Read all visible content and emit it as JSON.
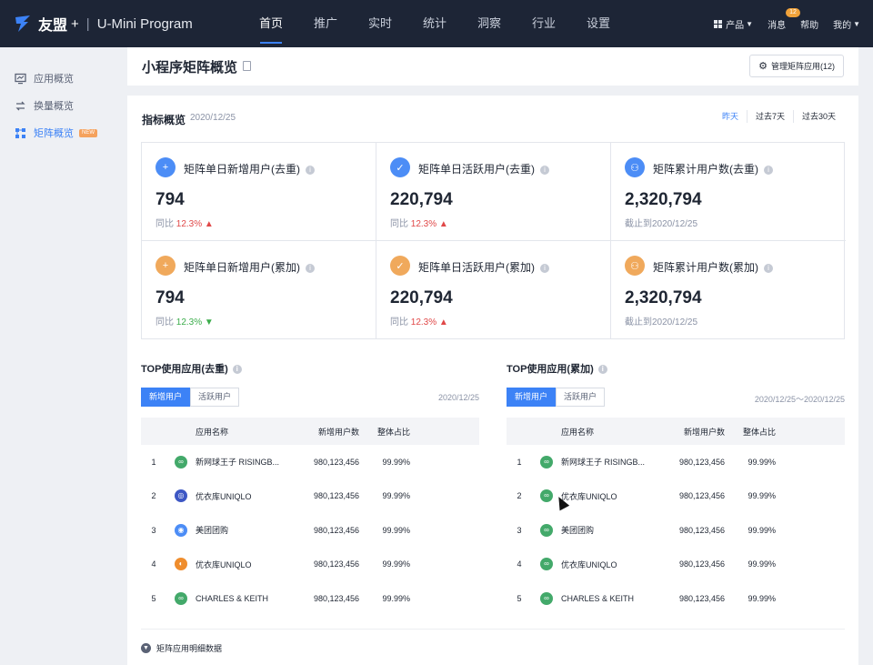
{
  "topbar": {
    "brand": "友盟",
    "plus": "+",
    "separator": "|",
    "product": "U-Mini Program",
    "nav": [
      "首页",
      "推广",
      "实时",
      "统计",
      "洞察",
      "行业",
      "设置"
    ],
    "active_nav": "首页",
    "tools": {
      "products": "产品",
      "messages": "消息",
      "messages_badge": "12",
      "help": "帮助",
      "mine": "我的"
    }
  },
  "sidebar": {
    "items": [
      {
        "label": "应用概览",
        "icon": "monitor-icon",
        "active": false
      },
      {
        "label": "换量概览",
        "icon": "swap-icon",
        "active": false
      },
      {
        "label": "矩阵概览",
        "icon": "matrix-icon",
        "active": true,
        "tag": "NEW"
      }
    ]
  },
  "header": {
    "title": "小程序矩阵概览",
    "manage_button": "管理矩阵应用(12)"
  },
  "overview": {
    "title": "指标概览",
    "date": "2020/12/25",
    "ranges": [
      "昨天",
      "过去7天",
      "过去30天"
    ],
    "active_range": "昨天",
    "metrics": [
      {
        "label": "矩阵单日新增用户(去重)",
        "value": "794",
        "sub_prefix": "同比",
        "change": "12.3%",
        "direction": "up",
        "icon_color": "blue",
        "icon": "user-plus-icon"
      },
      {
        "label": "矩阵单日活跃用户(去重)",
        "value": "220,794",
        "sub_prefix": "同比",
        "change": "12.3%",
        "direction": "up",
        "icon_color": "blue",
        "icon": "user-active-icon"
      },
      {
        "label": "矩阵累计用户数(去重)",
        "value": "2,320,794",
        "sub_prefix": "截止到2020/12/25",
        "change": "",
        "direction": "",
        "icon_color": "blue",
        "icon": "users-icon"
      },
      {
        "label": "矩阵单日新增用户(累加)",
        "value": "794",
        "sub_prefix": "同比",
        "change": "12.3%",
        "direction": "down",
        "icon_color": "orange",
        "icon": "user-plus-icon"
      },
      {
        "label": "矩阵单日活跃用户(累加)",
        "value": "220,794",
        "sub_prefix": "同比",
        "change": "12.3%",
        "direction": "up",
        "icon_color": "orange",
        "icon": "user-active-icon"
      },
      {
        "label": "矩阵累计用户数(累加)",
        "value": "2,320,794",
        "sub_prefix": "截止到2020/12/25",
        "change": "",
        "direction": "",
        "icon_color": "orange",
        "icon": "users-icon"
      }
    ]
  },
  "top_apps": [
    {
      "title": "TOP使用应用(去重)",
      "tabs": [
        "新增用户",
        "活跃用户"
      ],
      "active_tab": "新增用户",
      "date": "2020/12/25",
      "columns": [
        "应用名称",
        "新增用户数",
        "整体占比"
      ],
      "rows": [
        {
          "rank": "1",
          "name": "新网球王子 RISINGB...",
          "count": "980,123,456",
          "pct": "99.99%",
          "share": 1.0,
          "icon_color": "#43a96a"
        },
        {
          "rank": "2",
          "name": "优衣库UNIQLO",
          "count": "980,123,456",
          "pct": "99.99%",
          "share": 0.55,
          "icon_color": "#3d57c4"
        },
        {
          "rank": "3",
          "name": "美团团购",
          "count": "980,123,456",
          "pct": "99.99%",
          "share": 0.45,
          "icon_color": "#4c8df6"
        },
        {
          "rank": "4",
          "name": "优衣库UNIQLO",
          "count": "980,123,456",
          "pct": "99.99%",
          "share": 0.28,
          "icon_color": "#ef8d2d"
        },
        {
          "rank": "5",
          "name": "CHARLES & KEITH",
          "count": "980,123,456",
          "pct": "99.99%",
          "share": 0.08,
          "icon_color": "#43a96a"
        }
      ]
    },
    {
      "title": "TOP使用应用(累加)",
      "tabs": [
        "新增用户",
        "活跃用户"
      ],
      "active_tab": "新增用户",
      "date": "2020/12/25～2020/12/25",
      "columns": [
        "应用名称",
        "新增用户数",
        "整体占比"
      ],
      "rows": [
        {
          "rank": "1",
          "name": "新网球王子 RISINGB...",
          "count": "980,123,456",
          "pct": "99.99%",
          "share": 1.0,
          "icon_color": "#43a96a"
        },
        {
          "rank": "2",
          "name": "优衣库UNIQLO",
          "count": "980,123,456",
          "pct": "99.99%",
          "share": 0.55,
          "icon_color": "#43a96a"
        },
        {
          "rank": "3",
          "name": "美团团购",
          "count": "980,123,456",
          "pct": "99.99%",
          "share": 0.42,
          "icon_color": "#43a96a"
        },
        {
          "rank": "4",
          "name": "优衣库UNIQLO",
          "count": "980,123,456",
          "pct": "99.99%",
          "share": 0.28,
          "icon_color": "#43a96a"
        },
        {
          "rank": "5",
          "name": "CHARLES & KEITH",
          "count": "980,123,456",
          "pct": "99.99%",
          "share": 0.06,
          "icon_color": "#43a96a"
        }
      ]
    }
  ],
  "footer": {
    "expand_label": "矩阵应用明细数据"
  },
  "colors": {
    "accent": "#3c82f6",
    "topbar": "#1d2536",
    "up": "#e04848",
    "down": "#3bad4b"
  }
}
